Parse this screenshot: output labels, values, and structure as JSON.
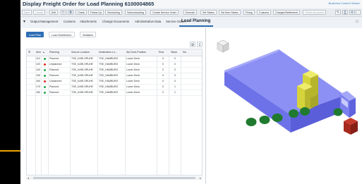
{
  "window": {
    "title": "Display Freight Order for Load Planning 6100004865",
    "system_link": "Business Context Viewer"
  },
  "toolbar": {
    "buttons": [
      {
        "label": "Save",
        "enabled": false
      },
      {
        "label": "Cancel",
        "enabled": false
      },
      {
        "label": "Edit",
        "enabled": true
      },
      {
        "label": "Check",
        "enabled": true
      },
      {
        "label": "Follow Up",
        "enabled": true
      },
      {
        "label": "Scheduling",
        "enabled": true
      },
      {
        "label": "Subcontracting",
        "enabled": true
      },
      {
        "label": "Create Service Order",
        "enabled": true
      },
      {
        "label": "Execute",
        "enabled": true
      },
      {
        "label": "Set Status",
        "enabled": true
      },
      {
        "label": "Set Item Status",
        "enabled": true
      },
      {
        "label": "Fixing",
        "enabled": true
      },
      {
        "label": "Customs",
        "enabled": true
      },
      {
        "label": "Charges/Settlement",
        "enabled": true
      },
      {
        "label": "Check document",
        "enabled": false
      }
    ]
  },
  "tabs": {
    "items": [
      "Output Management",
      "Customs",
      "Attachments",
      "Change Documents",
      "Administrative Data",
      "Service Orders",
      "Load Planning"
    ],
    "active": "Load Planning"
  },
  "subtabs": {
    "items": [
      "Load Plan",
      "Load Distribution",
      "Statistics"
    ],
    "active": "Load Plan"
  },
  "table": {
    "headers": [
      "Item",
      "Planning",
      "Source Location",
      "Destination Lo...",
      "Spl Deck Position",
      "Row",
      "Stack",
      "Sw"
    ],
    "rows": [
      {
        "item": "110",
        "status": "green",
        "planning": "Planned",
        "source": "TSE_KARLSRUHE",
        "dest": "TSE_HAMBURG",
        "deck": "Lower Deck",
        "row": "0",
        "stack": "0"
      },
      {
        "item": "120",
        "status": "red",
        "planning": "Unplanned",
        "source": "TSE_KARLSRUHE",
        "dest": "TSE_HAMBURG",
        "deck": "Lower Deck",
        "row": "0",
        "stack": "0"
      },
      {
        "item": "140",
        "status": "green",
        "planning": "Planned",
        "source": "TSE_KARLSRUHE",
        "dest": "TSE_HAMBURG",
        "deck": "Lower Deck",
        "row": "0",
        "stack": "0"
      },
      {
        "item": "150",
        "status": "green",
        "planning": "Planned",
        "source": "TSE_KARLSRUHE",
        "dest": "TSE_HAMBURG",
        "deck": "Lower Deck",
        "row": "0",
        "stack": "0"
      },
      {
        "item": "160",
        "status": "red",
        "planning": "Unplanned",
        "source": "TSE_KARLSRUHE",
        "dest": "TSE_HAMBURG",
        "deck": "Lower Deck",
        "row": "0",
        "stack": "0"
      },
      {
        "item": "170",
        "status": "green",
        "planning": "Planned",
        "source": "TSE_KARLSRUHE",
        "dest": "TSE_HAMBURG",
        "deck": "Lower Deck",
        "row": "0",
        "stack": "1"
      },
      {
        "item": "180",
        "status": "green",
        "planning": "Planned",
        "source": "TSE_KARLSRUHE",
        "dest": "TSE_HAMBURG",
        "deck": "Lower Deck",
        "row": "0",
        "stack": "1"
      }
    ]
  },
  "colors": {
    "accent": "#2e6eb5",
    "planned": "#1fa64a",
    "unplanned": "#d9261c",
    "truck": "#7b7ff0",
    "cargo": "#d6d43a",
    "wheel": "#1f7a2f",
    "external_box": "#a7281d"
  }
}
